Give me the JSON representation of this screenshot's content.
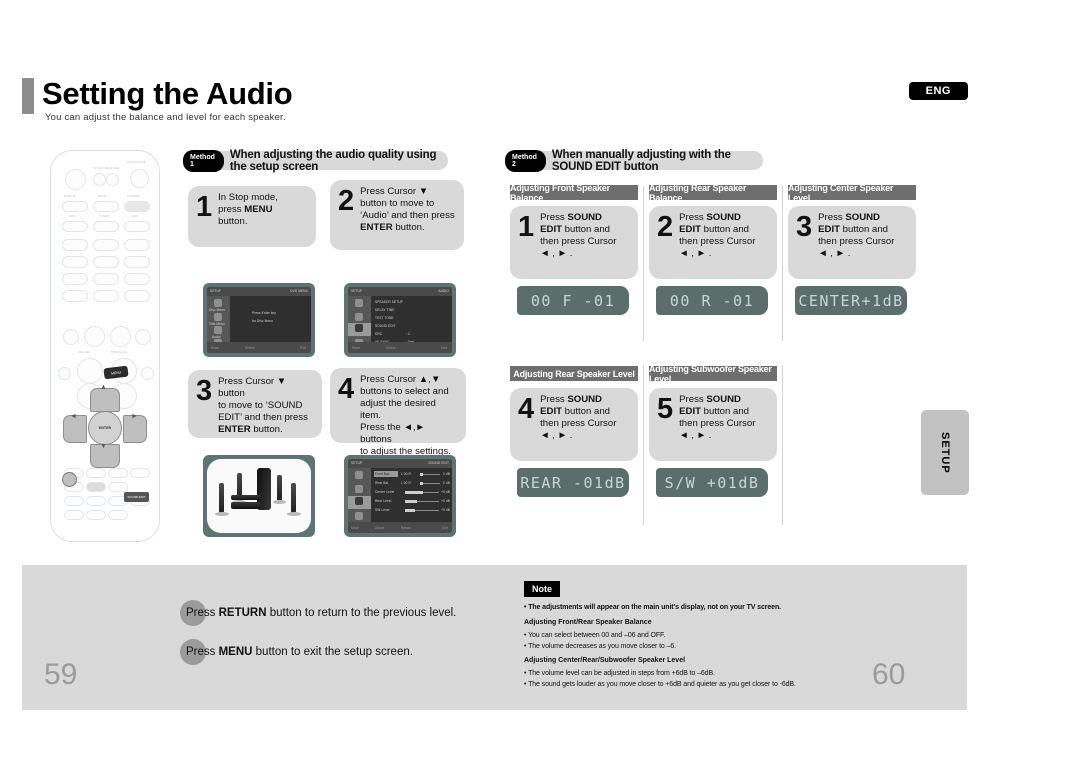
{
  "header": {
    "title": "Setting the Audio",
    "subtitle": "You can adjust the balance and level for each speaker.",
    "lang_badge": "ENG"
  },
  "side_tab": {
    "label": "SETUP"
  },
  "method1": {
    "pill": "Method 1",
    "heading": "When adjusting the audio quality using the setup screen",
    "steps": [
      {
        "num": "1",
        "html": "In Stop mode,<br>press <b>MENU</b><br>button."
      },
      {
        "num": "2",
        "html": "Press Cursor &#9660;<br>button to move to<br>&#8216;Audio&#8217; and then press<br><b>ENTER</b> button."
      },
      {
        "num": "3",
        "html": "Press Cursor &#9660; button<br>to move to &#8216;SOUND<br>EDIT&#8217; and then press<br><b>ENTER</b> button."
      },
      {
        "num": "4",
        "html": "Press Cursor &#9650;,&#9660;<br>buttons to select and<br>adjust the desired item.<br>Press the &#9668;,&#9658; buttons<br>to adjust the settings."
      }
    ],
    "screen1": {
      "left_menu": [
        "Disc Menu",
        "Title Menu",
        "Audio",
        "Setup"
      ],
      "title_right": "DVD MENU",
      "body": [
        "Press Enter key",
        "for Disc Menu"
      ],
      "footer": [
        "Move",
        "Select",
        "Exit"
      ]
    },
    "screen2": {
      "title_right": "AUDIO",
      "rows": [
        {
          "label": "SPEAKER SETUP",
          "value": ""
        },
        {
          "label": "DELAY TIME",
          "value": ""
        },
        {
          "label": "TEST TONE",
          "value": ""
        },
        {
          "label": "SOUND EDIT",
          "value": ""
        },
        {
          "label": "DRC",
          "value": ": 2"
        },
        {
          "label": "AV SYNC",
          "value": ": 0ms"
        }
      ],
      "footer": [
        "Move",
        "Select",
        "Exit"
      ]
    },
    "screen4": {
      "title_right": "SOUND EDIT",
      "rows": [
        {
          "label": "Front Bal.",
          "value": "L 00 R",
          "right": "0 dB"
        },
        {
          "label": "Rear Bal.",
          "value": "L 00 R",
          "right": "0 dB"
        },
        {
          "label": "Center Level",
          "value": "",
          "right": "+0 dB"
        },
        {
          "label": "Rear Level",
          "value": "",
          "right": "+0 dB"
        },
        {
          "label": "SW Level",
          "value": "",
          "right": "+0 dB"
        }
      ],
      "footer": [
        "Move",
        "Adjust",
        "Return",
        "Exit"
      ]
    }
  },
  "method2": {
    "pill": "Method 2",
    "heading": "When manually adjusting with the SOUND EDIT button",
    "sections": [
      {
        "title": "Adjusting Front Speaker Balance",
        "num": "1",
        "html": "Press <b>SOUND</b><br><b>EDIT</b> button and<br>then press Cursor<br>&#9668; , &#9658; .",
        "lcd": "00 F -01"
      },
      {
        "title": "Adjusting Rear Speaker Balance",
        "num": "2",
        "html": "Press <b>SOUND</b><br><b>EDIT</b> button and<br>then press Cursor<br>&#9668; , &#9658; .",
        "lcd": "00 R -01"
      },
      {
        "title": "Adjusting Center Speaker Level",
        "num": "3",
        "html": "Press <b>SOUND</b><br><b>EDIT</b> button and<br>then press Cursor<br>&#9668; , &#9658; .",
        "lcd": "CENTER+1dB"
      },
      {
        "title": "Adjusting Rear Speaker Level",
        "num": "4",
        "html": "Press <b>SOUND</b><br><b>EDIT</b> button and<br>then press Cursor<br>&#9668; , &#9658; .",
        "lcd": "REAR -01dB"
      },
      {
        "title": "Adjusting Subwoofer Speaker Level",
        "num": "5",
        "html": "Press <b>SOUND</b><br><b>EDIT</b> button and<br>then press Cursor<br>&#9668; , &#9658; .",
        "lcd": "S/W  +01dB"
      }
    ]
  },
  "footer": {
    "left_page": "59",
    "right_page": "60",
    "lines": [
      "Press <b>RETURN</b> button to return to the previous level.",
      "Press <b>MENU</b> button to exit the setup screen."
    ],
    "note": {
      "tag": "Note",
      "items": [
        {
          "type": "bullet",
          "text": "• The adjustments will appear on the main unit's display, not on your TV screen."
        },
        {
          "type": "head",
          "text": "Adjusting Front/Rear Speaker Balance"
        },
        {
          "type": "bullet",
          "text": "• You can select between 00 and –06 and OFF."
        },
        {
          "type": "bullet",
          "text": "• The volume decreases as you move closer to –6."
        },
        {
          "type": "head",
          "text": "Adjusting Center/Rear/Subwoofer Speaker Level"
        },
        {
          "type": "bullet",
          "text": "• The volume level can be adjusted in steps from +6dB to –6dB."
        },
        {
          "type": "bullet",
          "text": "• The sound gets louder as you move closer to +6dB and quieter as you get closer to -6dB."
        }
      ]
    }
  },
  "colors": {
    "card_grey": "#d9d9d9",
    "section_grey": "#6e6e6e",
    "lcd_bg": "#5c6e6b",
    "lcd_text": "#c9d6d4",
    "tv_bezel": "#5d7472"
  }
}
